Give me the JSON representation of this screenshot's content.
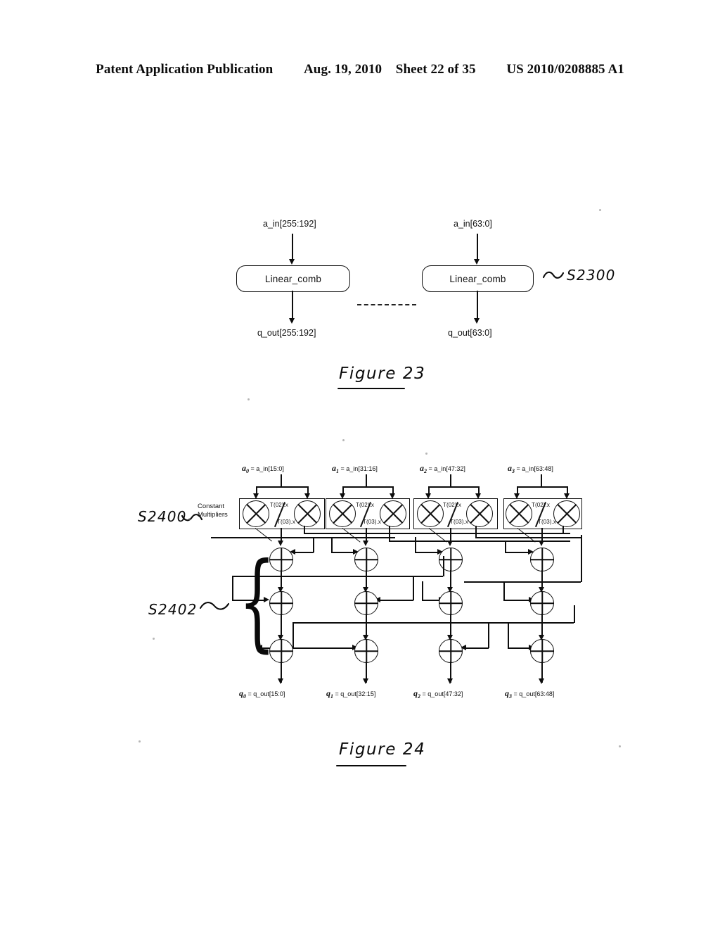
{
  "header": {
    "publication": "Patent Application Publication",
    "date": "Aug. 19, 2010",
    "sheet": "Sheet 22 of 35",
    "patent_number": "US 2010/0208885 A1"
  },
  "figure23": {
    "caption": "Figure 23",
    "reference": "S2300",
    "blocks": [
      {
        "label": "Linear_comb",
        "input": "a_in[255:192]",
        "output": "q_out[255:192]"
      },
      {
        "label": "Linear_comb",
        "input": "a_in[63:0]",
        "output": "q_out[63:0]"
      }
    ]
  },
  "figure24": {
    "caption": "Figure 24",
    "reference_multipliers": "S2400",
    "reference_adders": "S2402",
    "constant_multipliers_label_line1": "Constant",
    "constant_multipliers_label_line2": "Multipliers",
    "multiplier_upper_label": "T(02).x",
    "multiplier_lower_label": "T(03).x",
    "inputs": [
      {
        "symbol": "a",
        "subscript": "0",
        "equals": "=",
        "value": "a_in[15:0]"
      },
      {
        "symbol": "a",
        "subscript": "1",
        "equals": "=",
        "value": "a_in[31:16]"
      },
      {
        "symbol": "a",
        "subscript": "2",
        "equals": "=",
        "value": "a_in[47:32]"
      },
      {
        "symbol": "a",
        "subscript": "3",
        "equals": "=",
        "value": "a_in[63:48]"
      }
    ],
    "outputs": [
      {
        "symbol": "q",
        "subscript": "0",
        "equals": "=",
        "value": "q_out[15:0]"
      },
      {
        "symbol": "q",
        "subscript": "1",
        "equals": "=",
        "value": "q_out[32:15]"
      },
      {
        "symbol": "q",
        "subscript": "2",
        "equals": "=",
        "value": "q_out[47:32]"
      },
      {
        "symbol": "q",
        "subscript": "3",
        "equals": "=",
        "value": "q_out[63:48]"
      }
    ],
    "adder_rows": 3,
    "adder_columns": 4
  },
  "colors": {
    "ink": "#101010",
    "paper": "#ffffff"
  }
}
